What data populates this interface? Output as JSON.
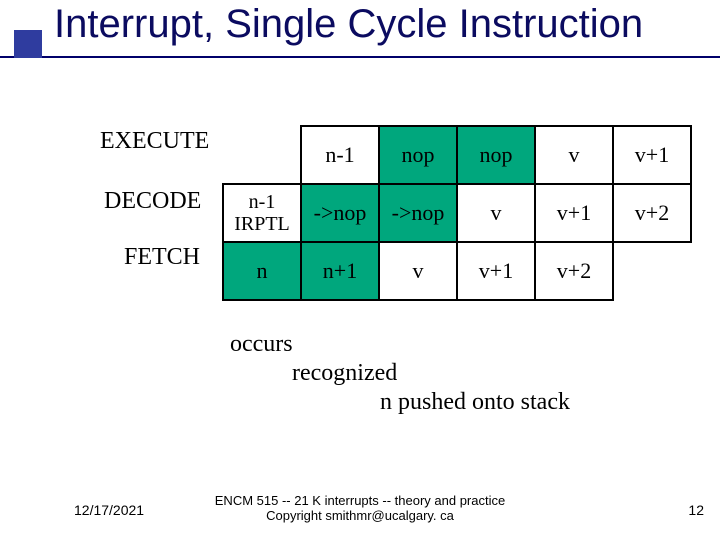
{
  "title": "Interrupt, Single Cycle Instruction",
  "labels": {
    "execute": "EXECUTE",
    "decode": "DECODE",
    "fetch": "FETCH"
  },
  "table": {
    "r0": [
      "",
      "n-1",
      "nop",
      "nop",
      "v",
      "v+1"
    ],
    "r1": [
      "n-1\nIRPTL",
      "->nop",
      "->nop",
      "v",
      "v+1",
      "v+2"
    ],
    "r2": [
      "n",
      "n+1",
      "v",
      "v+1",
      "v+2",
      ""
    ]
  },
  "events": {
    "l1": "occurs",
    "l2": "recognized",
    "l3": "n pushed onto stack"
  },
  "footer": {
    "date": "12/17/2021",
    "line1": "ENCM 515 -- 21 K interrupts -- theory and practice",
    "line2": "Copyright smithmr@ucalgary. ca",
    "page": "12"
  }
}
